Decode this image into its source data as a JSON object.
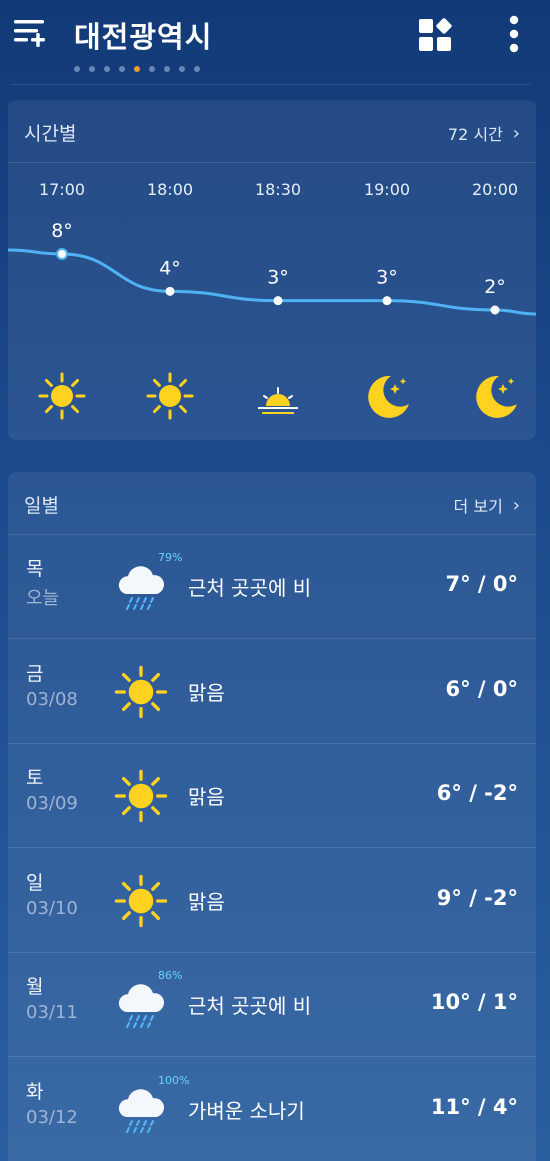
{
  "header": {
    "title": "대전광역시",
    "page_dots_count": 9,
    "active_dot_index": 4
  },
  "hourly": {
    "section_title": "시간별",
    "link_label": "72 시간",
    "items": [
      {
        "time": "17:00",
        "temp": "8°",
        "icon": "sun-icon"
      },
      {
        "time": "18:00",
        "temp": "4°",
        "icon": "sun-icon"
      },
      {
        "time": "18:30",
        "temp": "3°",
        "icon": "sunset-icon"
      },
      {
        "time": "19:00",
        "temp": "3°",
        "icon": "moon-stars-icon"
      },
      {
        "time": "20:00",
        "temp": "2°",
        "icon": "moon-stars-icon"
      }
    ]
  },
  "daily": {
    "section_title": "일별",
    "link_label": "더 보기",
    "rows": [
      {
        "day": "목",
        "date": "오늘",
        "icon": "rain-cloud-icon",
        "pop": "79%",
        "desc": "근처 곳곳에 비",
        "range": "7° / 0°"
      },
      {
        "day": "금",
        "date": "03/08",
        "icon": "sun-icon",
        "pop": "",
        "desc": "맑음",
        "range": "6° / 0°"
      },
      {
        "day": "토",
        "date": "03/09",
        "icon": "sun-icon",
        "pop": "",
        "desc": "맑음",
        "range": "6° / -2°"
      },
      {
        "day": "일",
        "date": "03/10",
        "icon": "sun-icon",
        "pop": "",
        "desc": "맑음",
        "range": "9° / -2°"
      },
      {
        "day": "월",
        "date": "03/11",
        "icon": "rain-cloud-icon",
        "pop": "86%",
        "desc": "근처 곳곳에 비",
        "range": "10° / 1°"
      },
      {
        "day": "화",
        "date": "03/12",
        "icon": "rain-cloud-icon",
        "pop": "100%",
        "desc": "가벼운 소나기",
        "range": "11° / 4°"
      }
    ]
  },
  "colors": {
    "accent": "#f39a2c",
    "sun": "#ffd21f",
    "temp_line": "#4fb2f5",
    "pop_text": "#6ad0ff"
  }
}
